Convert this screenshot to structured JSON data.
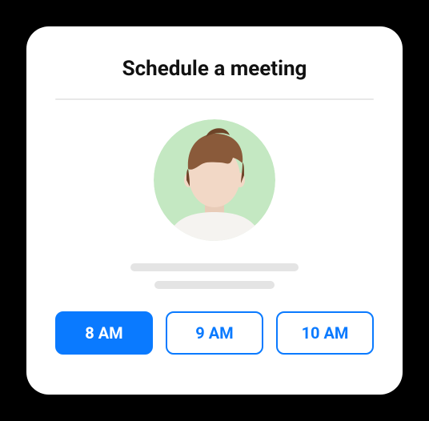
{
  "title": "Schedule a meeting",
  "time_slots": [
    {
      "label": "8 AM",
      "selected": true
    },
    {
      "label": "9 AM",
      "selected": false
    },
    {
      "label": "10 AM",
      "selected": false
    }
  ]
}
